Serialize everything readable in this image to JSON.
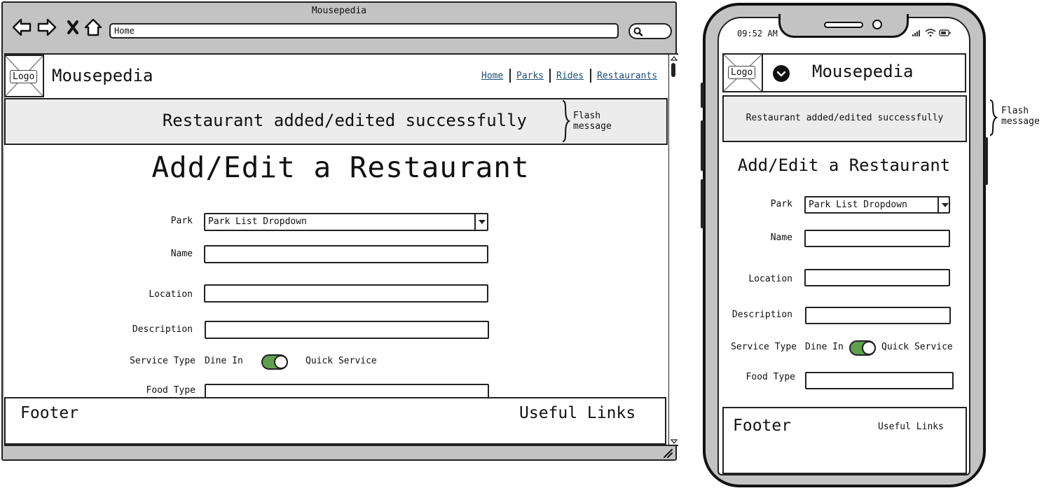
{
  "browser": {
    "title": "Mousepedia",
    "address": "Home"
  },
  "site": {
    "logo_label": "Logo",
    "title": "Mousepedia",
    "nav": [
      "Home",
      "Parks",
      "Rides",
      "Restaurants"
    ]
  },
  "flash": {
    "message": "Restaurant added/edited successfully",
    "note": [
      "Flash",
      "message"
    ]
  },
  "form": {
    "heading": "Add/Edit a Restaurant",
    "park_label": "Park",
    "park_value": "Park List Dropdown",
    "name_label": "Name",
    "location_label": "Location",
    "description_label": "Description",
    "service_label": "Service Type",
    "service_left": "Dine In",
    "service_right": "Quick Service",
    "food_label": "Food Type"
  },
  "footer": {
    "title": "Footer",
    "links": "Useful Links"
  },
  "phone": {
    "time": "09:52 AM"
  },
  "colors": {
    "chrome": "#c3c3c3",
    "flash_bg": "#ececec",
    "toggle_on": "#5fa04e",
    "link": "#1f4f7a"
  }
}
